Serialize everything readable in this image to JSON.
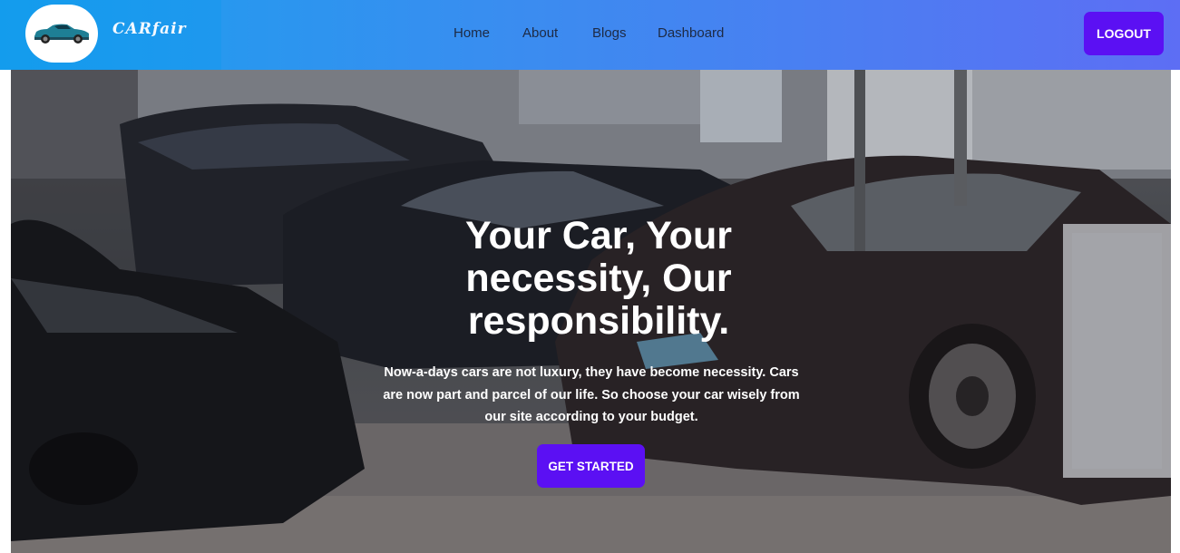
{
  "navbar": {
    "brand": "CARfair",
    "logo_icon": "car-icon",
    "links": [
      {
        "label": "Home"
      },
      {
        "label": "About"
      },
      {
        "label": "Blogs"
      },
      {
        "label": "Dashboard"
      }
    ],
    "logout_label": "LOGOUT"
  },
  "hero": {
    "title": "Your Car, Your necessity, Our responsibility.",
    "text": "Now-a-days cars are not luxury, they have become necessity. Cars are now part and parcel of our life. So choose your car wisely from our site according to your budget.",
    "cta_label": "GET STARTED",
    "background": "car-showroom-photo"
  },
  "colors": {
    "accent": "#5b10f3",
    "nav_gradient_start": "#1aa0ee",
    "nav_gradient_end": "#5d6ef4"
  }
}
